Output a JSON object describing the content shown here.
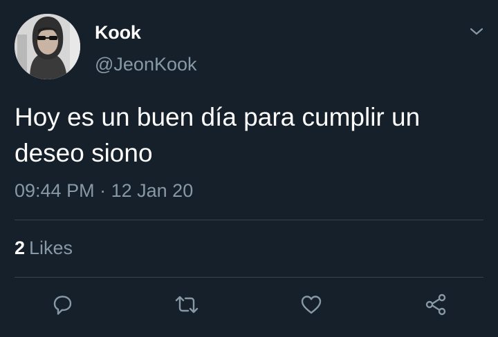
{
  "tweet": {
    "display_name": "Kook",
    "handle": "@JeonKook",
    "text": "Hoy es un buen día para cumplir un deseo siono",
    "time": "09:44 PM",
    "separator": "·",
    "date": "12 Jan 20",
    "likes_count": "2",
    "likes_label": "Likes"
  },
  "icons": {
    "menu": "chevron-down-icon",
    "reply": "reply-icon",
    "retweet": "retweet-icon",
    "like": "heart-icon",
    "share": "share-icon"
  },
  "colors": {
    "background": "#15202b",
    "primary_text": "#ffffff",
    "secondary_text": "#8899a6",
    "divider": "#38444d"
  }
}
